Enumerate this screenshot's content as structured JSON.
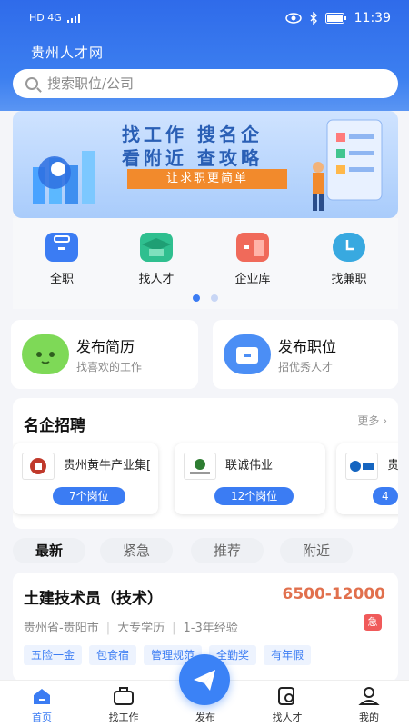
{
  "statusbar": {
    "left": "HD 4G",
    "time": "11:39"
  },
  "app": {
    "title": "贵州人才网"
  },
  "search": {
    "placeholder": "搜索职位/公司"
  },
  "banner": {
    "line1": "找工作  搜名企",
    "line2": "看附近  查攻略",
    "slogan": "让求职更简单"
  },
  "categories": [
    {
      "label": "全职",
      "icon": "briefcase-icon",
      "color": "#3b7cf3"
    },
    {
      "label": "找人才",
      "icon": "graduation-cap-icon",
      "color": "#2fbf8f"
    },
    {
      "label": "企业库",
      "icon": "company-icon",
      "color": "#f06a5a"
    },
    {
      "label": "找兼职",
      "icon": "part-time-icon",
      "color": "#38a9e0"
    }
  ],
  "actions": [
    {
      "title": "发布简历",
      "sub": "找喜欢的工作",
      "icon": "resume-face-icon",
      "color": "#7ed957"
    },
    {
      "title": "发布职位",
      "sub": "招优秀人才",
      "icon": "folder-icon",
      "color": "#4b8ef5"
    }
  ],
  "famous": {
    "title": "名企招聘",
    "more": "更多",
    "companies": [
      {
        "name": "贵州黄牛产业集[",
        "positions": "7个岗位"
      },
      {
        "name": "联诚伟业",
        "positions": "12个岗位"
      },
      {
        "name": "贵",
        "positions": "4"
      }
    ]
  },
  "tabs": [
    "最新",
    "紧急",
    "推荐",
    "附近"
  ],
  "job": {
    "title": "土建技术员（技术）",
    "salary": "6500-12000",
    "location": "贵州省-贵阳市",
    "education": "大专学历",
    "experience": "1-3年经验",
    "urgent": "急",
    "tags": [
      "五险一金",
      "包食宿",
      "管理规范",
      "全勤奖",
      "有年假"
    ]
  },
  "nav": [
    {
      "label": "首页"
    },
    {
      "label": "找工作"
    },
    {
      "label": "发布"
    },
    {
      "label": "找人才"
    },
    {
      "label": "我的"
    }
  ],
  "colors": {
    "primary": "#3b7cf3",
    "salary": "#e1704d",
    "urgent": "#f05a5a",
    "slogan": "#f28a2c"
  }
}
